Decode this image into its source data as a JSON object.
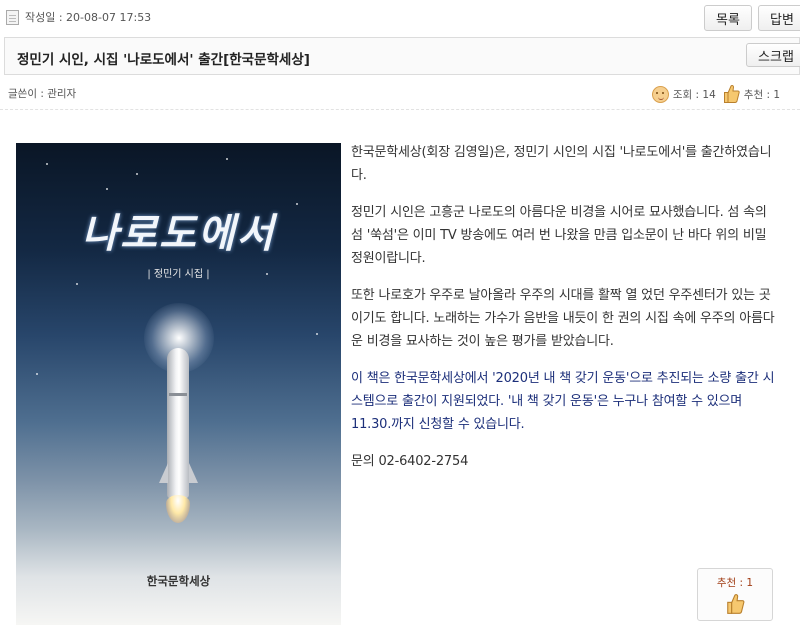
{
  "header": {
    "date_label": "작성일 : 20-08-07 17:53",
    "list_button": "목록",
    "reply_button": "답변"
  },
  "post": {
    "title": "정민기 시인, 시집 '나로도에서' 출간[한국문학세상]",
    "scrap_button": "스크랩",
    "author_label": "글쓴이 : 관리자",
    "views_label": "조회 : 14",
    "recommend_label": "추천 : 1"
  },
  "cover": {
    "title": "나로도에서",
    "subtitle": "| 정민기 시집 |",
    "publisher": "한국문학세상"
  },
  "body": {
    "paragraphs": [
      "한국문학세상(회장 김영일)은, 정민기 시인의 시집 '나로도에서'를 출간하였습니다.",
      "정민기 시인은 고흥군 나로도의 아름다운 비경을 시어로 묘사했습니다. 섬 속의 섬 '쑥섬'은 이미 TV 방송에도 여러 번 나왔을 만큼 입소문이 난 바다 위의 비밀 정원이랍니다.",
      "또한 나로호가 우주로 날아올라 우주의 시대를 활짝 열 었던 우주센터가 있는 곳이기도 합니다. 노래하는 가수가 음반을 내듯이 한 권의 시집 속에 우주의 아름다운 비경을 묘사하는 것이 높은 평가를 받았습니다.",
      "이 책은 한국문학세상에서 '2020년 내 책 갖기 운동'으로 추진되는 소량 출간 시스템으로 출간이 지원되었다. '내 책 갖기 운동'은 누구나 참여할 수 있으며 11.30.까지 신청할 수 있습니다.",
      "문의 02-6402-2754"
    ]
  },
  "recommend_box": {
    "label": "추천 : 1"
  },
  "colors": {
    "accent_blue": "#1c2f7a",
    "recommend_text": "#a03c14"
  },
  "icons": [
    "document-icon",
    "smiley-icon",
    "thumbs-up-icon"
  ]
}
